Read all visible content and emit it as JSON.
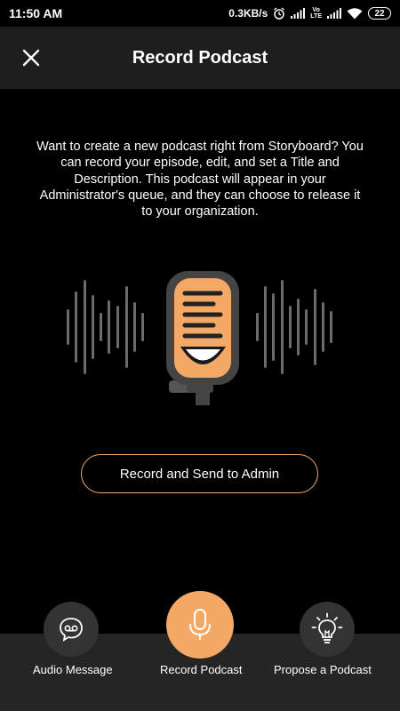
{
  "status_bar": {
    "time": "11:50 AM",
    "network_speed": "0.3KB/s",
    "volte": "Vo\nLTE",
    "battery": "22"
  },
  "app_bar": {
    "title": "Record Podcast",
    "close_icon": "close-icon"
  },
  "main": {
    "description": "Want to create a new podcast right from Storyboard? You can record your episode, edit, and set a Title and Description. This podcast will appear in your Administrator's queue, and they can choose to release it to your organization.",
    "illustration": "microphone-sound-waves-illustration",
    "primary_button": "Record and Send to Admin"
  },
  "bottom_nav": {
    "items": [
      {
        "label": "Audio Message",
        "icon": "voicemail-icon",
        "active": false
      },
      {
        "label": "Record Podcast",
        "icon": "microphone-icon",
        "active": true
      },
      {
        "label": "Propose a Podcast",
        "icon": "lightbulb-icon",
        "active": false
      }
    ]
  },
  "colors": {
    "accent": "#f5a96a",
    "mic_body": "#f3a866",
    "app_bar_bg": "#1e1e1e",
    "bottom_nav_bg": "#252525",
    "inactive_circle": "#333333"
  }
}
